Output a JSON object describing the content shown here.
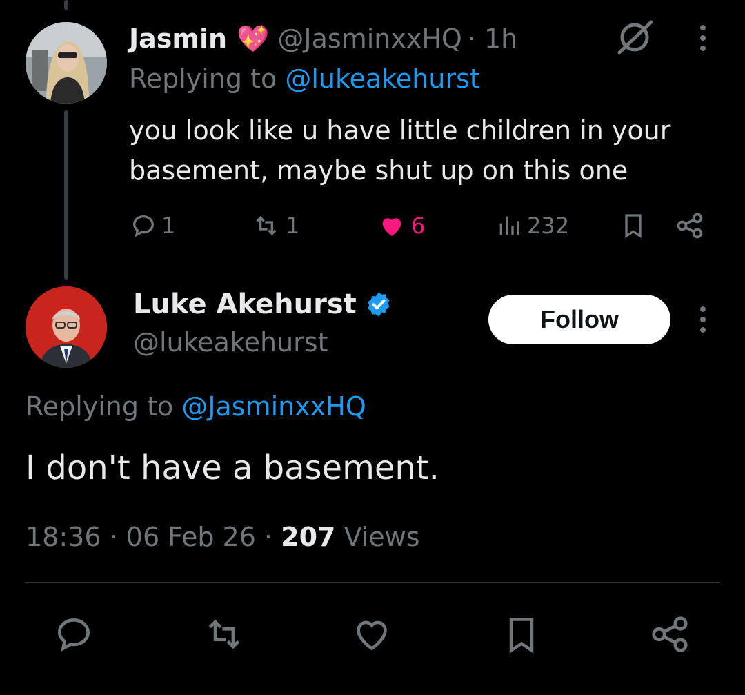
{
  "reply": {
    "display_name": "Jasmin",
    "emoji": "💖",
    "handle": "@JasminxxHQ",
    "time": "· 1h",
    "replying_prefix": "Replying to ",
    "replying_to": "@lukeakehurst",
    "text": "you look like u have little children in your basement, maybe shut up on this one",
    "counts": {
      "replies": "1",
      "reposts": "1",
      "likes": "6",
      "views": "232"
    }
  },
  "tweet": {
    "display_name": "Luke Akehurst",
    "handle": "@lukeakehurst",
    "follow_label": "Follow",
    "replying_prefix": "Replying to ",
    "replying_to": "@JasminxxHQ",
    "text": "I don't have a basement.",
    "time": "18:36",
    "sep": " · ",
    "date": "06 Feb 26",
    "views_count": "207",
    "views_label": " Views"
  },
  "icons": [
    "comment-icon",
    "repost-icon",
    "heart-icon",
    "views-icon",
    "bookmark-icon",
    "share-icon",
    "grok-icon",
    "more-icon",
    "verified-badge-icon"
  ],
  "colors": {
    "like": "#f91880",
    "link": "#1d9bf0",
    "muted": "#71767b",
    "verified": "#1d9bf0"
  }
}
